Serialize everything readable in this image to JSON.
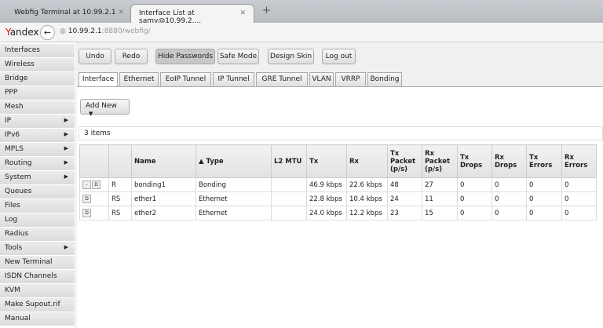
{
  "browser": {
    "tabs": [
      {
        "title": "Webfig Terminal at 10.99.2.1"
      },
      {
        "title": "Interface List at samy@10.99.2...."
      }
    ],
    "logo": "Yandex",
    "url_host": "10.99.2.1",
    "url_rest": ":8880/webfig/"
  },
  "sidebar": {
    "items": [
      {
        "label": "Interfaces"
      },
      {
        "label": "Wireless"
      },
      {
        "label": "Bridge"
      },
      {
        "label": "PPP"
      },
      {
        "label": "Mesh"
      },
      {
        "label": "IP",
        "arrow": true
      },
      {
        "label": "IPv6",
        "arrow": true
      },
      {
        "label": "MPLS",
        "arrow": true
      },
      {
        "label": "Routing",
        "arrow": true
      },
      {
        "label": "System",
        "arrow": true
      },
      {
        "label": "Queues"
      },
      {
        "label": "Files"
      },
      {
        "label": "Log"
      },
      {
        "label": "Radius"
      },
      {
        "label": "Tools",
        "arrow": true
      },
      {
        "label": "New Terminal"
      },
      {
        "label": "ISDN Channels"
      },
      {
        "label": "KVM"
      },
      {
        "label": "Make Supout.rif"
      },
      {
        "label": "Manual"
      }
    ]
  },
  "toolbar": {
    "undo": "Undo",
    "redo": "Redo",
    "hide_passwords": "Hide Passwords",
    "safe_mode": "Safe Mode",
    "design_skin": "Design Skin",
    "logout": "Log out"
  },
  "tabs": [
    "Interface",
    "Ethernet",
    "EoIP Tunnel",
    "IP Tunnel",
    "GRE Tunnel",
    "VLAN",
    "VRRP",
    "Bonding"
  ],
  "add_new": "Add New",
  "item_count": "3 items",
  "table": {
    "headers": [
      "",
      "",
      "Name",
      "▲ Type",
      "L2 MTU",
      "Tx",
      "Rx",
      "Tx Packet (p/s)",
      "Rx Packet (p/s)",
      "Tx Drops",
      "Rx Drops",
      "Tx Errors",
      "Rx Errors"
    ],
    "rows": [
      {
        "buttons": [
          "-",
          "D"
        ],
        "flags": "R",
        "name": "bonding1",
        "type": "Bonding",
        "l2mtu": "",
        "tx": "46.9 kbps",
        "rx": "22.6 kbps",
        "txp": "48",
        "rxp": "27",
        "txd": "0",
        "rxd": "0",
        "txe": "0",
        "rxe": "0"
      },
      {
        "buttons": [
          "D"
        ],
        "flags": "RS",
        "name": "ether1",
        "type": "Ethernet",
        "l2mtu": "",
        "tx": "22.8 kbps",
        "rx": "10.4 kbps",
        "txp": "24",
        "rxp": "11",
        "txd": "0",
        "rxd": "0",
        "txe": "0",
        "rxe": "0"
      },
      {
        "buttons": [
          "D"
        ],
        "flags": "RS",
        "name": "ether2",
        "type": "Ethernet",
        "l2mtu": "",
        "tx": "24.0 kbps",
        "rx": "12.2 kbps",
        "txp": "23",
        "rxp": "15",
        "txd": "0",
        "rxd": "0",
        "txe": "0",
        "rxe": "0"
      }
    ]
  }
}
